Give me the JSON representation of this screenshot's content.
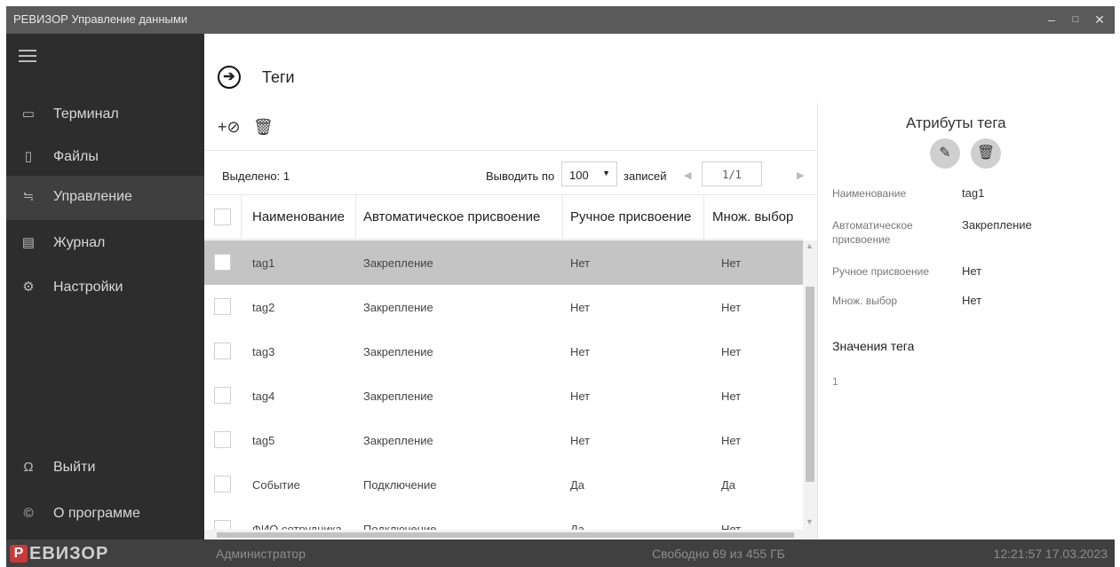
{
  "window": {
    "title": "РЕВИЗОР Управление данными",
    "minimize": "–",
    "maximize": "□",
    "close": "✕"
  },
  "sidebar": {
    "items": [
      {
        "label": "Терминал",
        "icon": "terminal-icon"
      },
      {
        "label": "Файлы",
        "icon": "files-icon"
      },
      {
        "label": "Управление",
        "icon": "sliders-icon",
        "active": true
      },
      {
        "label": "Журнал",
        "icon": "journal-icon"
      },
      {
        "label": "Настройки",
        "icon": "gear-icon"
      }
    ],
    "bottom": [
      {
        "label": "Выйти",
        "icon": "user-icon"
      },
      {
        "label": "О программе",
        "icon": "copyright-icon"
      }
    ]
  },
  "page": {
    "title": "Теги"
  },
  "toolbar": {
    "add_tag": "add-tag-icon",
    "delete": "trash-icon"
  },
  "grid": {
    "selected_label": "Выделено: 1",
    "page_size_label": "Выводить по",
    "page_size": "100",
    "records_label": "записей",
    "page_indicator": "1/1",
    "columns": [
      "Наименование",
      "Автоматическое присвоение",
      "Ручное присвоение",
      "Множ. выбор"
    ],
    "rows": [
      {
        "name": "tag1",
        "auto": "Закрепление",
        "manual": "Нет",
        "multi": "Нет",
        "selected": true
      },
      {
        "name": "tag2",
        "auto": "Закрепление",
        "manual": "Нет",
        "multi": "Нет"
      },
      {
        "name": "tag3",
        "auto": "Закрепление",
        "manual": "Нет",
        "multi": "Нет"
      },
      {
        "name": "tag4",
        "auto": "Закрепление",
        "manual": "Нет",
        "multi": "Нет"
      },
      {
        "name": "tag5",
        "auto": "Закрепление",
        "manual": "Нет",
        "multi": "Нет"
      },
      {
        "name": "Событие",
        "auto": "Подключение",
        "manual": "Да",
        "multi": "Да"
      },
      {
        "name": "ФИО сотрудника",
        "auto": "Подключение",
        "manual": "Да",
        "multi": "Нет"
      }
    ]
  },
  "attributes": {
    "title": "Атрибуты тега",
    "fields": [
      {
        "label": "Наименование",
        "value": "tag1"
      },
      {
        "label": "Автоматическое присвоение",
        "value": "Закрепление"
      },
      {
        "label": "Ручное присвоение",
        "value": "Нет"
      },
      {
        "label": "Множ. выбор",
        "value": "Нет"
      }
    ],
    "values_title": "Значения тега",
    "values": [
      "1"
    ]
  },
  "status": {
    "logo_letter": "Р",
    "logo_text": "ЕВИЗОР",
    "user": "Администратор",
    "free": "Свободно 69 из 455 ГБ",
    "time": "12:21:57 17.03.2023"
  }
}
